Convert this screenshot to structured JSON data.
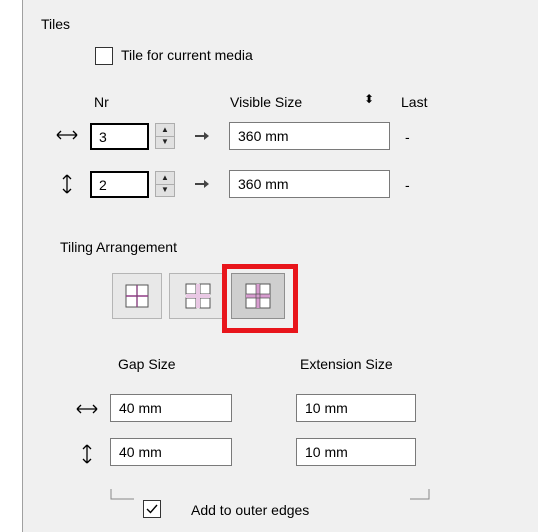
{
  "tiles": {
    "group_label": "Tiles",
    "tile_for_current_media": {
      "label": "Tile for current media",
      "checked": false
    },
    "columns": {
      "nr": "Nr",
      "visible_size": "Visible Size",
      "last": "Last"
    },
    "rows": [
      {
        "icon": "horizontal-double-arrow-icon",
        "nr_value": "3",
        "visible_size": "360 mm",
        "last": "-"
      },
      {
        "icon": "vertical-double-arrow-icon",
        "nr_value": "2",
        "visible_size": "360 mm",
        "last": "-"
      }
    ]
  },
  "tiling_arrangement": {
    "label": "Tiling Arrangement",
    "options": [
      {
        "name": "grid-overlap",
        "selected": false
      },
      {
        "name": "grid-separated",
        "selected": false
      },
      {
        "name": "grid-extended",
        "selected": true
      }
    ]
  },
  "gap_extension": {
    "gap_label": "Gap Size",
    "extension_label": "Extension Size",
    "rows": [
      {
        "icon": "horizontal-double-arrow-icon",
        "gap": "40 mm",
        "extension": "10 mm"
      },
      {
        "icon": "vertical-double-arrow-icon",
        "gap": "40 mm",
        "extension": "10 mm"
      }
    ],
    "add_to_outer_edges": {
      "label": "Add to outer edges",
      "checked": true
    }
  },
  "colors": {
    "highlight": "#e8151b",
    "panel": "#f0f0f0",
    "tile_accent": "#b030a0"
  }
}
